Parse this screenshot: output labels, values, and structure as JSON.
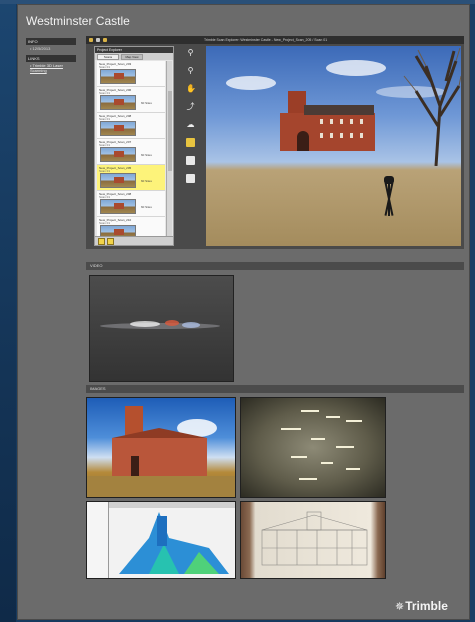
{
  "page": {
    "title": "Westminster Castle"
  },
  "nav": {
    "info_header": "INFO",
    "info_date": "• 12/5/2013",
    "links_header": "LINKS",
    "link_item": "• Trimble 3D Laser Scanning"
  },
  "viewer": {
    "bar_title": "Trimble Scan Explorer: Westminster Castle - New_Project_Scan_205 / Scan 01",
    "explorer_title": "Project Explorer",
    "tab_scans": "Scans",
    "tab_map": "Map View",
    "scans": [
      {
        "name": "New_Project_Scan_203",
        "sub": "Scan 01",
        "count": "",
        "selected": false
      },
      {
        "name": "New_Project_Scan_206",
        "sub": "Scan 01",
        "count": "60 Sites",
        "selected": false
      },
      {
        "name": "New_Project_Scan_208",
        "sub": "Scan 01",
        "count": "",
        "selected": false
      },
      {
        "name": "New_Project_Scan_207",
        "sub": "Scan 01",
        "count": "60 Sites",
        "selected": false
      },
      {
        "name": "New_Project_Scan_205",
        "sub": "Scan 01",
        "count": "60 Sites",
        "selected": true
      },
      {
        "name": "New_Project_Scan_208",
        "sub": "Scan 01",
        "count": "60 Sites",
        "selected": false
      },
      {
        "name": "New_Project_Scan_210",
        "sub": "Scan 01",
        "count": "",
        "selected": false
      }
    ]
  },
  "sections": {
    "video": "VIDEO",
    "images": "IMAGES"
  },
  "branding": {
    "logo_text": "Trimble",
    "logo_mark": "✵"
  },
  "icons": [
    "zoom-in-icon",
    "zoom-out-icon",
    "pan-icon",
    "measure-icon",
    "annotation-icon",
    "camera-icon",
    "settings-icon",
    "export-icon"
  ]
}
